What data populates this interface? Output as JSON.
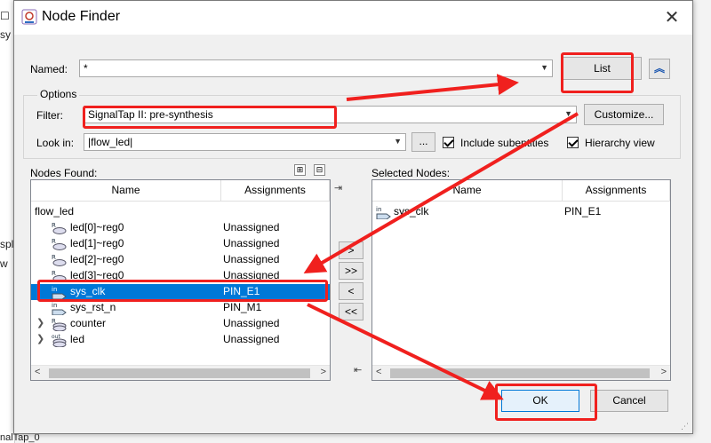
{
  "background": {
    "text1": "sy",
    "text2": "spl",
    "text3": "w",
    "text4": "nalTap_0"
  },
  "dialog": {
    "title": "Node Finder",
    "close": "✕"
  },
  "named": {
    "label": "Named:",
    "value": "*"
  },
  "buttons": {
    "list": "List",
    "customize": "Customize...",
    "browse": "...",
    "ok": "OK",
    "cancel": "Cancel",
    "collapse": "︽"
  },
  "options": {
    "label": "Options",
    "filter_label": "Filter:",
    "filter_value": "SignalTap II: pre-synthesis",
    "lookin_label": "Look in:",
    "lookin_value": "|flow_led|",
    "include_subentities": "Include subentities",
    "hierarchy_view": "Hierarchy view"
  },
  "nodes_found": {
    "label": "Nodes Found:",
    "col_name": "Name",
    "col_assignments": "Assignments",
    "root": "flow_led",
    "rows": [
      {
        "name": "led[0]~reg0",
        "assign": "Unassigned",
        "icon": "R"
      },
      {
        "name": "led[1]~reg0",
        "assign": "Unassigned",
        "icon": "R"
      },
      {
        "name": "led[2]~reg0",
        "assign": "Unassigned",
        "icon": "R"
      },
      {
        "name": "led[3]~reg0",
        "assign": "Unassigned",
        "icon": "R"
      },
      {
        "name": "sys_clk",
        "assign": "PIN_E1",
        "icon": "in"
      },
      {
        "name": "sys_rst_n",
        "assign": "PIN_M1",
        "icon": "in"
      },
      {
        "name": "counter",
        "assign": "Unassigned",
        "icon": "R"
      },
      {
        "name": "led",
        "assign": "Unassigned",
        "icon": "out"
      }
    ]
  },
  "selected_nodes": {
    "label": "Selected Nodes:",
    "col_name": "Name",
    "col_assignments": "Assignments",
    "rows": [
      {
        "name": "sys_clk",
        "assign": "PIN_E1",
        "icon": "in"
      }
    ]
  },
  "transfer": {
    "add": ">",
    "add_all": ">>",
    "remove": "<",
    "remove_all": "<<"
  },
  "colors": {
    "selection": "#0078d7",
    "annotation": "#f0201e"
  }
}
